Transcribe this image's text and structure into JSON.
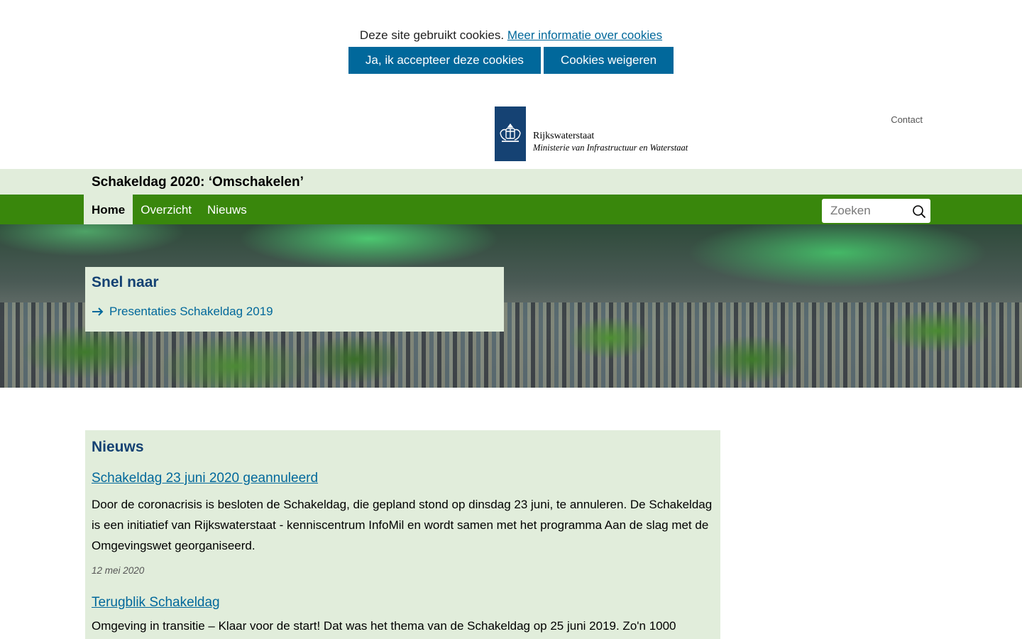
{
  "cookie": {
    "message": "Deze site gebruikt cookies.",
    "more_info_link": "Meer informatie over cookies",
    "accept_label": "Ja, ik accepteer deze cookies",
    "decline_label": "Cookies weigeren"
  },
  "header": {
    "logo_line1": "Rijkswaterstaat",
    "logo_line2": "Ministerie van Infrastructuur en Waterstaat",
    "contact_label": "Contact"
  },
  "site": {
    "title": "Schakeldag 2020: ‘Omschakelen’"
  },
  "nav": {
    "items": [
      {
        "label": "Home",
        "active": true
      },
      {
        "label": "Overzicht",
        "active": false
      },
      {
        "label": "Nieuws",
        "active": false
      }
    ],
    "search_placeholder": "Zoeken"
  },
  "quick": {
    "title": "Snel naar",
    "link_label": "Presentaties Schakeldag 2019"
  },
  "news": {
    "heading": "Nieuws",
    "items": [
      {
        "title": "Schakeldag 23 juni 2020 geannuleerd",
        "body": "Door de coronacrisis is besloten de Schakeldag, die gepland stond op dinsdag 23 juni, te annuleren. De Schakeldag is een initiatief van Rijkswaterstaat - kenniscentrum InfoMil en wordt samen met het programma Aan de slag met de Omgevingswet georganiseerd.",
        "date": "12 mei 2020"
      },
      {
        "title": "Terugblik Schakeldag",
        "body": "Omgeving in transitie – Klaar voor de start!  Dat was het thema van de Schakeldag op 25 juni  2019.  Zo'n 1000"
      }
    ]
  },
  "colors": {
    "brand_blue": "#154273",
    "link_blue": "#01689b",
    "nav_green": "#39870c",
    "light_green": "#e1eddb"
  }
}
